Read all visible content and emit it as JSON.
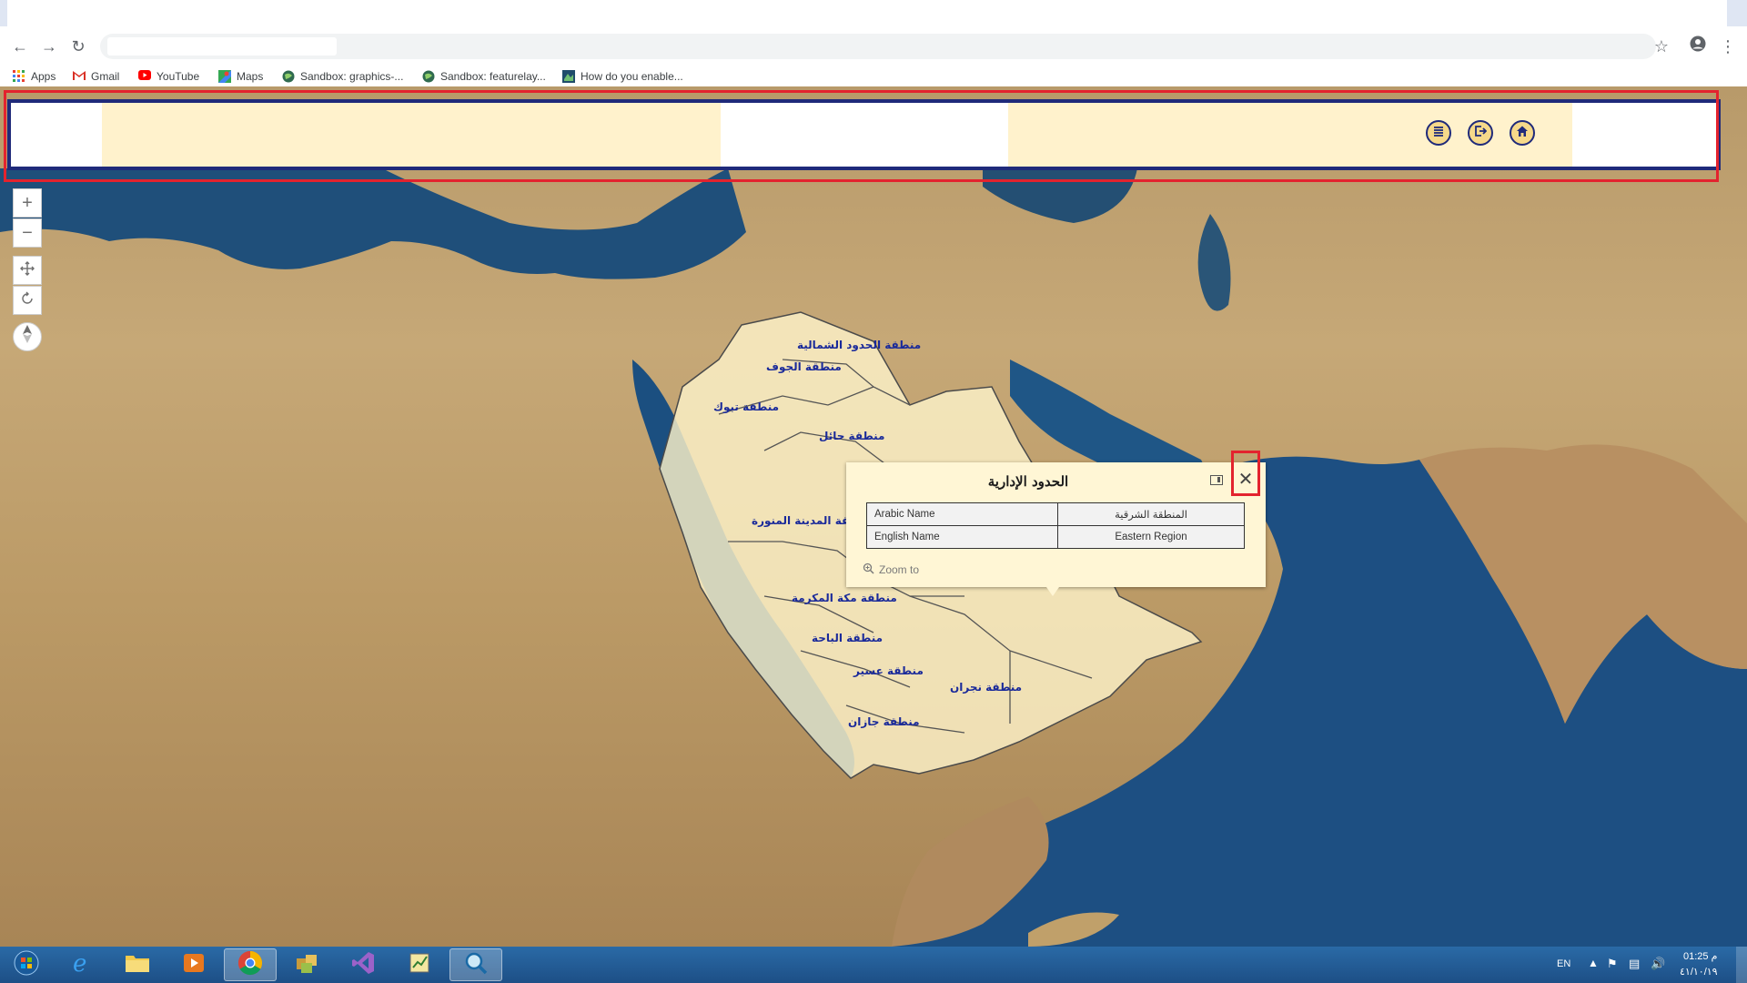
{
  "browser": {
    "bookmarks": [
      {
        "label": "Apps",
        "icon": "apps-grid-icon"
      },
      {
        "label": "Gmail",
        "icon": "gmail-icon"
      },
      {
        "label": "YouTube",
        "icon": "youtube-icon"
      },
      {
        "label": "Maps",
        "icon": "maps-icon"
      },
      {
        "label": "Sandbox: graphics-...",
        "icon": "sandbox-globe-icon"
      },
      {
        "label": "Sandbox: featurelay...",
        "icon": "sandbox-globe-icon"
      },
      {
        "label": "How do you enable...",
        "icon": "map-thumb-icon"
      }
    ]
  },
  "app": {
    "header_buttons": [
      "list-icon",
      "logout-icon",
      "home-icon"
    ]
  },
  "regions": [
    {
      "label": "منطقة الحدود الشمالية"
    },
    {
      "label": "منطقة الجوف"
    },
    {
      "label": "منطقة تبوك"
    },
    {
      "label": "منطقة حائل"
    },
    {
      "label": "منطقة المدينة المنورة"
    },
    {
      "label": "منطقة مكة المكرمة"
    },
    {
      "label": "منطقة الباحة"
    },
    {
      "label": "منطقة عسير"
    },
    {
      "label": "منطقة نجران"
    },
    {
      "label": "منطقة جازان"
    }
  ],
  "popup": {
    "title": "الحدود الإدارية",
    "rows": [
      {
        "field": "Arabic Name",
        "value": "المنطقة الشرقية"
      },
      {
        "field": "English Name",
        "value": "Eastern Region"
      }
    ],
    "zoom_label": "Zoom to"
  },
  "taskbar": {
    "lang": "EN",
    "time": "01:25 م",
    "date": "٤١/١٠/١٩"
  }
}
